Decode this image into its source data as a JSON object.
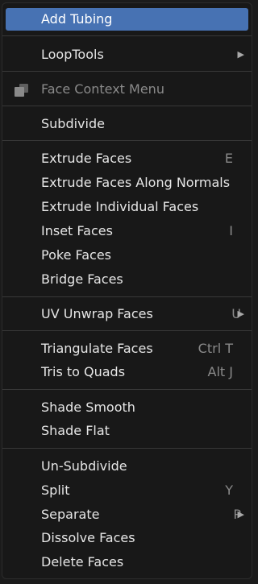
{
  "menu": {
    "items": {
      "add_tubing": {
        "label": "Add Tubing"
      },
      "looptools": {
        "label": "LoopTools"
      },
      "face_context_menu": {
        "label": "Face Context Menu",
        "icon": "face-select-icon"
      },
      "subdivide": {
        "label": "Subdivide"
      },
      "extrude_faces": {
        "label": "Extrude Faces",
        "shortcut": "E"
      },
      "extrude_normals": {
        "label": "Extrude Faces Along Normals"
      },
      "extrude_individual": {
        "label": "Extrude Individual Faces"
      },
      "inset_faces": {
        "label": "Inset Faces",
        "shortcut": "I"
      },
      "poke_faces": {
        "label": "Poke Faces"
      },
      "bridge_faces": {
        "label": "Bridge Faces"
      },
      "uv_unwrap": {
        "label": "UV Unwrap Faces",
        "shortcut": "U"
      },
      "triangulate": {
        "label": "Triangulate Faces",
        "shortcut": "Ctrl T"
      },
      "tris_to_quads": {
        "label": "Tris to Quads",
        "shortcut": "Alt J"
      },
      "shade_smooth": {
        "label": "Shade Smooth"
      },
      "shade_flat": {
        "label": "Shade Flat"
      },
      "un_subdivide": {
        "label": "Un-Subdivide"
      },
      "split": {
        "label": "Split",
        "shortcut": "Y"
      },
      "separate": {
        "label": "Separate",
        "shortcut": "P"
      },
      "dissolve_faces": {
        "label": "Dissolve Faces"
      },
      "delete_faces": {
        "label": "Delete Faces"
      }
    },
    "submenu_arrow": "▶",
    "colors": {
      "background": "#181818",
      "highlight": "#4772b3",
      "text": "#e6e6e6",
      "muted": "#8a8a8a"
    }
  }
}
